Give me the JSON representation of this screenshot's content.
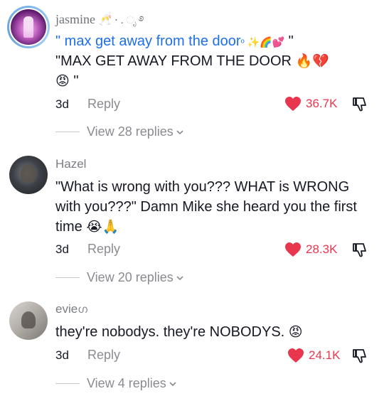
{
  "comments": [
    {
      "username": "jasmine",
      "username_decor": "🥂 ⋅ . ೃ ࿔",
      "text_blue": "max get away from the door",
      "text_blue_suffix": "ᵒ ✨🌈💕",
      "text_main": "\"MAX GET AWAY FROM THE DOOR",
      "text_main_emoji": "🔥💔",
      "text_line3_emoji": "😡",
      "text_line3_end": "\"",
      "time": "3d",
      "reply": "Reply",
      "likes": "36.7K",
      "view_replies": "View 28 replies"
    },
    {
      "username": "Hazel",
      "text": "\"What is wrong with you??? WHAT is WRONG with you???\" Damn Mike she heard you the first time",
      "text_emoji": "😭🙏",
      "time": "3d",
      "reply": "Reply",
      "likes": "28.3K",
      "view_replies": "View 20 replies"
    },
    {
      "username": "evie",
      "username_decor": "ഗ",
      "text": "they're nobodys. they're NOBODYS.",
      "text_emoji": "😡",
      "time": "3d",
      "reply": "Reply",
      "likes": "24.1K",
      "view_replies": "View 4 replies"
    }
  ],
  "colors": {
    "like": "#e8364f",
    "link": "#1e6fe8",
    "muted": "#8a8b91"
  },
  "icons": {
    "like": "heart-icon",
    "dislike": "dislike-icon",
    "expand": "chevron-down-icon"
  }
}
